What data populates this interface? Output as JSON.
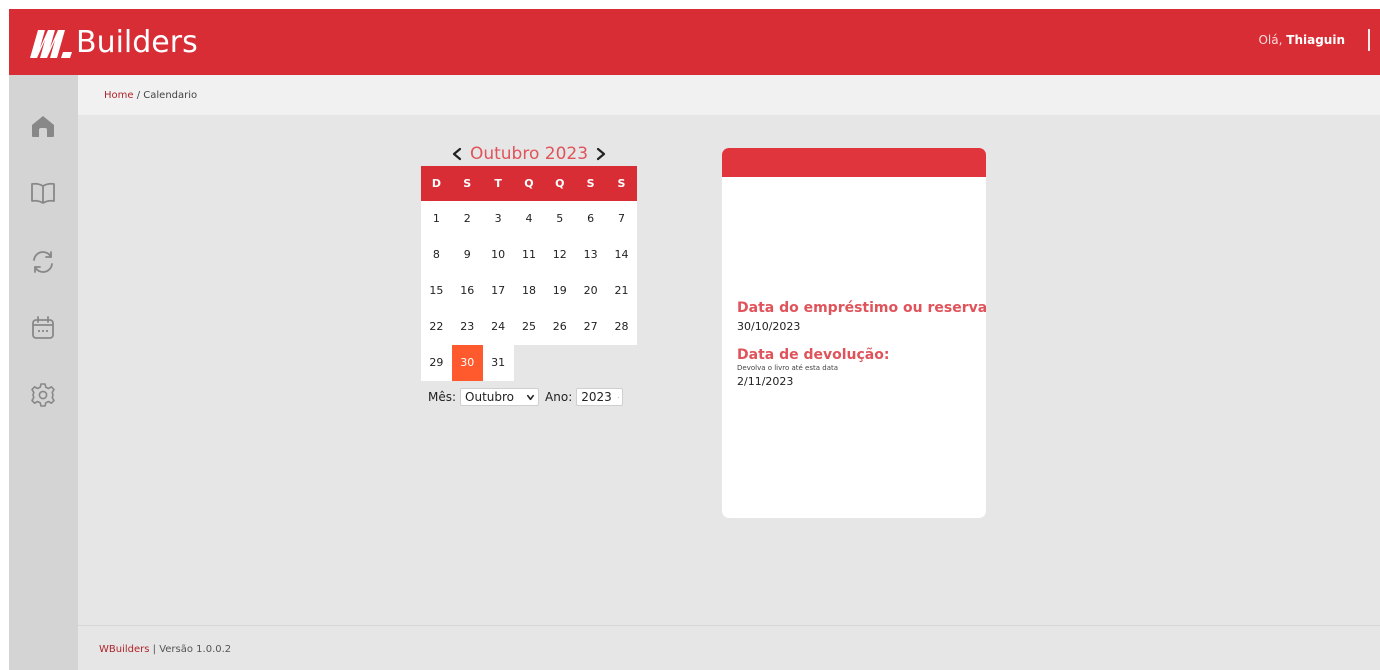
{
  "header": {
    "brand": "Builders",
    "greeting_prefix": "Olá,",
    "user_name": "Thiaguin"
  },
  "breadcrumb": {
    "home": "Home",
    "separator": "/",
    "current": "Calendario"
  },
  "sidebar": {
    "items": [
      {
        "name": "home",
        "icon": "home-icon"
      },
      {
        "name": "books",
        "icon": "book-icon"
      },
      {
        "name": "loans",
        "icon": "refresh-icon"
      },
      {
        "name": "calendar",
        "icon": "calendar-icon"
      },
      {
        "name": "settings",
        "icon": "gear-icon"
      }
    ]
  },
  "calendar": {
    "title": "Outubro 2023",
    "weekdays": [
      "D",
      "S",
      "T",
      "Q",
      "Q",
      "S",
      "S"
    ],
    "weeks": [
      [
        "1",
        "2",
        "3",
        "4",
        "5",
        "6",
        "7"
      ],
      [
        "8",
        "9",
        "10",
        "11",
        "12",
        "13",
        "14"
      ],
      [
        "15",
        "16",
        "17",
        "18",
        "19",
        "20",
        "21"
      ],
      [
        "22",
        "23",
        "24",
        "25",
        "26",
        "27",
        "28"
      ],
      [
        "29",
        "30",
        "31",
        "",
        "",
        "",
        ""
      ]
    ],
    "selected_day": "30",
    "month_label": "Mês:",
    "month_value": "Outubro",
    "year_label": "Ano:",
    "year_value": "2023"
  },
  "info": {
    "loan_title": "Data do empréstimo ou reserva:",
    "loan_date": "30/10/2023",
    "return_title": "Data de devolução:",
    "return_note": "Devolva o livro até esta data",
    "return_date": "2/11/2023"
  },
  "footer": {
    "brand": "WBuilders",
    "version": "| Versão 1.0.0.2"
  },
  "colors": {
    "primary": "#d92d36",
    "accent_text": "#e0535a",
    "selected_day": "#ff5a2e"
  }
}
